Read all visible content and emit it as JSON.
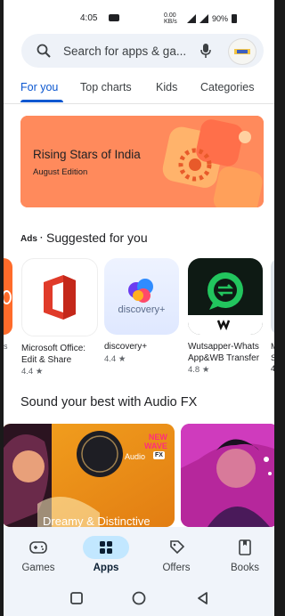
{
  "status_bar": {
    "time": "4:05",
    "net_speed": "0.00 KB/s",
    "battery": "90%"
  },
  "search": {
    "placeholder": "Search for apps & ga..."
  },
  "tabs": [
    {
      "label": "For you",
      "active": true
    },
    {
      "label": "Top charts",
      "active": false
    },
    {
      "label": "Kids",
      "active": false
    },
    {
      "label": "Categories",
      "active": false
    }
  ],
  "banner": {
    "title": "Rising Stars of India",
    "subtitle": "August Edition"
  },
  "suggested": {
    "ads_label": "Ads",
    "title": "Suggested for you"
  },
  "apps": [
    {
      "name": "Microsoft Office: Edit & Share",
      "rating": "4.4 ★"
    },
    {
      "name": "discovery+",
      "rating": "4.4 ★",
      "icon_text": "discovery+"
    },
    {
      "name": "Wutsapper-Whats App&WB Transfer",
      "rating": "4.8 ★"
    }
  ],
  "audio_fx": {
    "title": "Sound your best with Audio FX",
    "card1": {
      "badge_line1": "NEW",
      "badge_line2": "WAVE",
      "audio_label": "Audio",
      "fx_label": "FX",
      "caption": "Dreamy & Distinctive"
    }
  },
  "bottom_nav": [
    {
      "label": "Games",
      "icon": "gamepad-icon",
      "active": false
    },
    {
      "label": "Apps",
      "icon": "apps-grid-icon",
      "active": true
    },
    {
      "label": "Offers",
      "icon": "tag-icon",
      "active": false
    },
    {
      "label": "Books",
      "icon": "book-icon",
      "active": false
    }
  ],
  "colors": {
    "accent": "#0b57d0",
    "banner": "#ff8a5c",
    "nav_pill": "#c2e7ff"
  }
}
